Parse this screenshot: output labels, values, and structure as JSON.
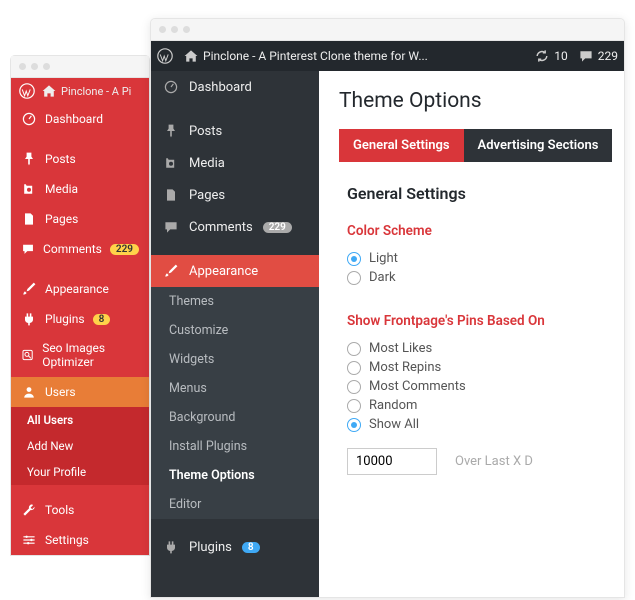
{
  "back": {
    "site": "Pinclone - A Pi",
    "menu": [
      "Dashboard",
      "Posts",
      "Media",
      "Pages",
      "Comments",
      "Appearance",
      "Plugins",
      "Seo Images Optimizer",
      "Users",
      "Tools",
      "Settings"
    ],
    "comments_badge": "229",
    "plugins_badge": "8",
    "users_sub": [
      "All Users",
      "Add New",
      "Your Profile"
    ]
  },
  "front": {
    "site": "Pinclone - A Pinterest Clone theme for W...",
    "updates": "10",
    "comments": "229",
    "menu": [
      "Dashboard",
      "Posts",
      "Media",
      "Pages",
      "Comments",
      "Appearance",
      "Plugins"
    ],
    "comments_badge": "229",
    "plugins_badge": "8",
    "appearance_sub": [
      "Themes",
      "Customize",
      "Widgets",
      "Menus",
      "Background",
      "Install Plugins",
      "Theme Options",
      "Editor"
    ]
  },
  "page": {
    "title": "Theme Options",
    "tabs": [
      "General Settings",
      "Advertising Sections"
    ],
    "section": "General Settings",
    "color_heading": "Color Scheme",
    "color_opts": [
      "Light",
      "Dark"
    ],
    "front_heading": "Show Frontpage's Pins Based On",
    "front_opts": [
      "Most Likes",
      "Most Repins",
      "Most Comments",
      "Random",
      "Show All"
    ],
    "input_val": "10000",
    "input_lbl": "Over Last X D"
  }
}
